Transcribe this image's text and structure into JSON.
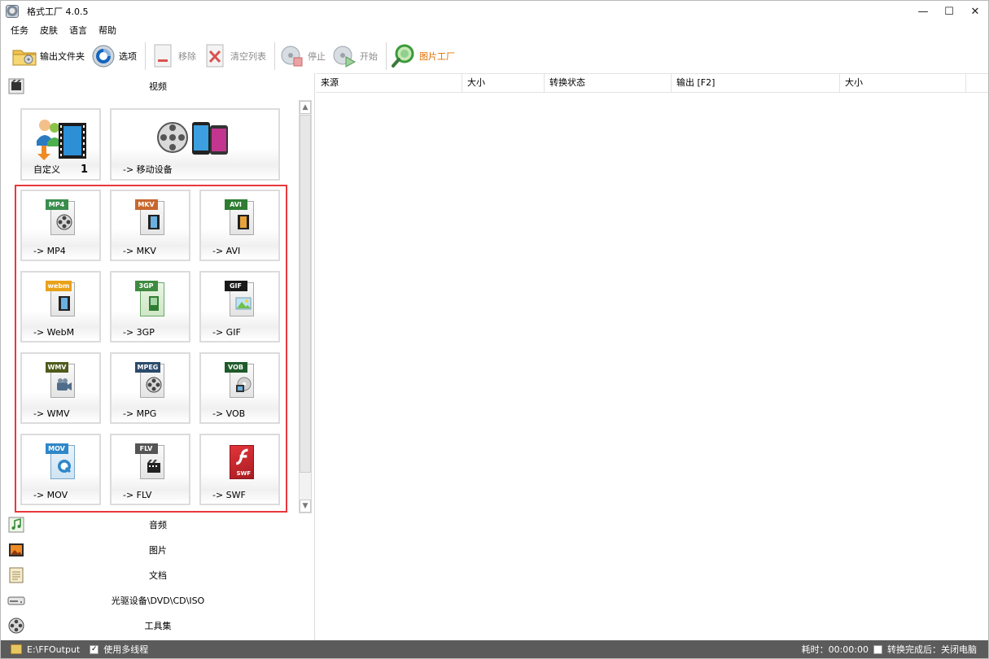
{
  "window": {
    "title": "格式工厂 4.0.5",
    "controls": {
      "minimize": "—",
      "maximize": "☐",
      "close": "✕"
    }
  },
  "menu": [
    "任务",
    "皮肤",
    "语言",
    "帮助"
  ],
  "toolbar": {
    "output_folder": "输出文件夹",
    "options": "选项",
    "remove": "移除",
    "clear_list": "清空列表",
    "stop": "停止",
    "start": "开始",
    "picture_factory": "图片工厂"
  },
  "categories": {
    "video": "视频",
    "audio": "音频",
    "picture": "图片",
    "document": "文档",
    "optical": "光驱设备\\DVD\\CD\\ISO",
    "tools": "工具集"
  },
  "top_tiles": {
    "custom": {
      "label": "自定义",
      "count": "1"
    },
    "mobile": {
      "label": "-> 移动设备"
    }
  },
  "formats": [
    {
      "label": "-> MP4",
      "tag": "MP4",
      "tag_color": "#3a8e4d"
    },
    {
      "label": "-> MKV",
      "tag": "MKV",
      "tag_color": "#c8672d"
    },
    {
      "label": "-> AVI",
      "tag": "AVI",
      "tag_color": "#2e7d32"
    },
    {
      "label": "-> WebM",
      "tag": "webm",
      "tag_color": "#e9a11a"
    },
    {
      "label": "-> 3GP",
      "tag": "3GP",
      "tag_color": "#3f8a3f"
    },
    {
      "label": "-> GIF",
      "tag": "GIF",
      "tag_color": "#1a1a1a"
    },
    {
      "label": "-> WMV",
      "tag": "WMV",
      "tag_color": "#4e5b1c"
    },
    {
      "label": "-> MPG",
      "tag": "MPEG",
      "tag_color": "#2b4a6b"
    },
    {
      "label": "-> VOB",
      "tag": "VOB",
      "tag_color": "#1f5a2b"
    },
    {
      "label": "-> MOV",
      "tag": "MOV",
      "tag_color": "#2f87c8"
    },
    {
      "label": "-> FLV",
      "tag": "FLV",
      "tag_color": "#555555"
    },
    {
      "label": "-> SWF",
      "tag": "SWF",
      "tag_color": "#c0282d"
    }
  ],
  "table": {
    "columns": [
      "来源",
      "大小",
      "转换状态",
      "输出 [F2]",
      "大小"
    ]
  },
  "status": {
    "output_path": "E:\\FFOutput",
    "multithread": "使用多线程",
    "elapsed": "耗时：00:00:00",
    "after_done": "转换完成后：关闭电脑"
  }
}
